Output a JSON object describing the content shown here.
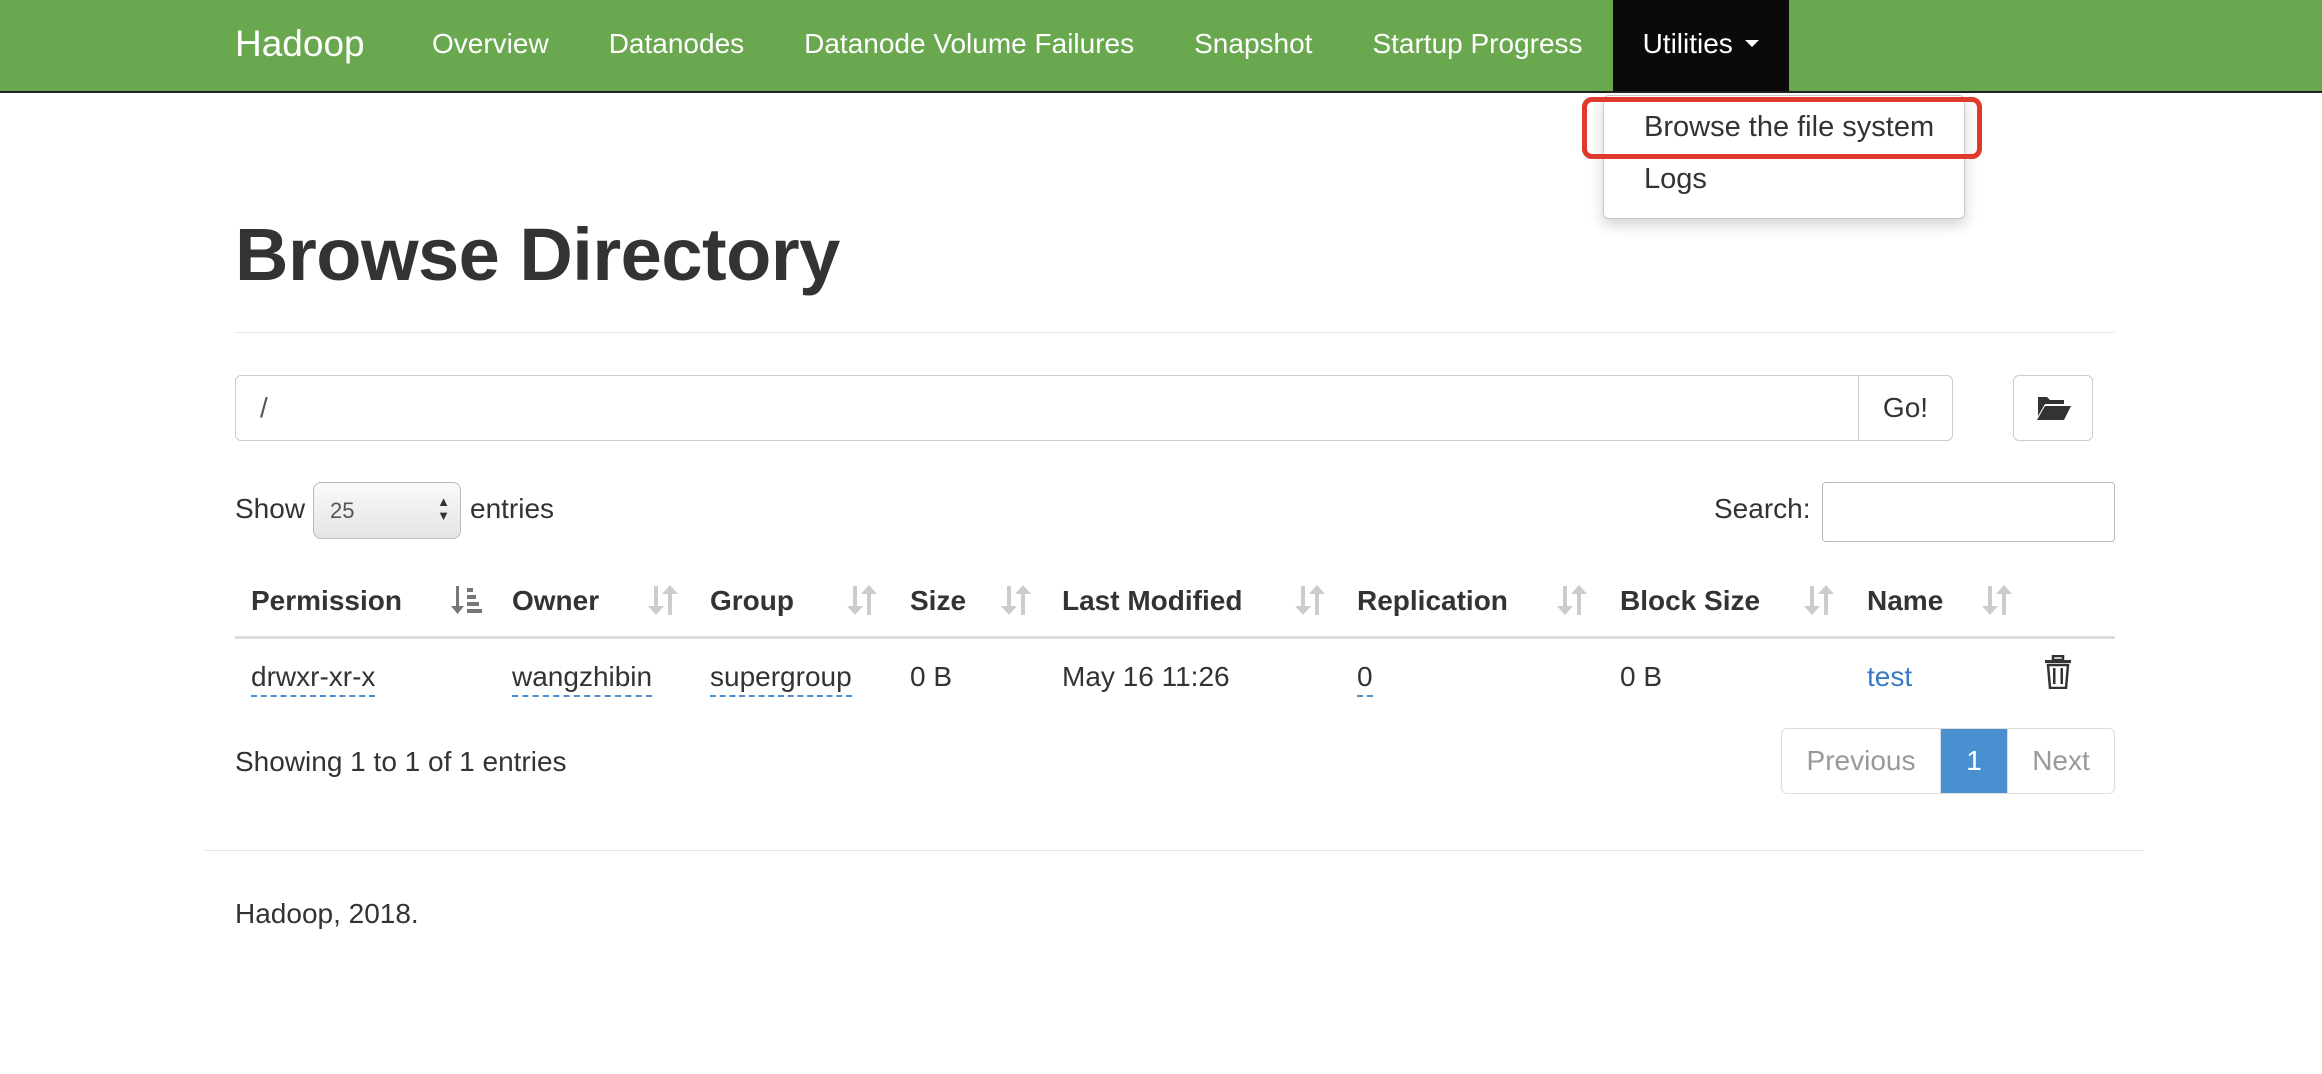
{
  "navbar": {
    "brand": "Hadoop",
    "items": [
      {
        "label": "Overview"
      },
      {
        "label": "Datanodes"
      },
      {
        "label": "Datanode Volume Failures"
      },
      {
        "label": "Snapshot"
      },
      {
        "label": "Startup Progress"
      },
      {
        "label": "Utilities"
      }
    ]
  },
  "dropdown": {
    "items": [
      {
        "label": "Browse the file system"
      },
      {
        "label": "Logs"
      }
    ]
  },
  "page": {
    "title": "Browse Directory"
  },
  "path_bar": {
    "value": "/",
    "go_label": "Go!",
    "folder_icon": "folder-open-icon"
  },
  "controls": {
    "show_label": "Show",
    "entries_value": "25",
    "entries_label": "entries",
    "search_label": "Search:"
  },
  "table": {
    "headers": [
      "Permission",
      "Owner",
      "Group",
      "Size",
      "Last Modified",
      "Replication",
      "Block Size",
      "Name"
    ],
    "rows": [
      {
        "permission": "drwxr-xr-x",
        "owner": "wangzhibin",
        "group": "supergroup",
        "size": "0 B",
        "last_modified": "May 16 11:26",
        "replication": "0",
        "block_size": "0 B",
        "name": "test"
      }
    ]
  },
  "info": {
    "text": "Showing 1 to 1 of 1 entries"
  },
  "pagination": {
    "previous": "Previous",
    "current": "1",
    "next": "Next"
  },
  "footer": {
    "text": "Hadoop, 2018."
  },
  "colors": {
    "navbar_bg": "#6aa84f",
    "active_nav_bg": "#0a0a0a",
    "link": "#3a7bc8",
    "highlight": "#e03a2c",
    "page_active": "#4a8fd0"
  }
}
